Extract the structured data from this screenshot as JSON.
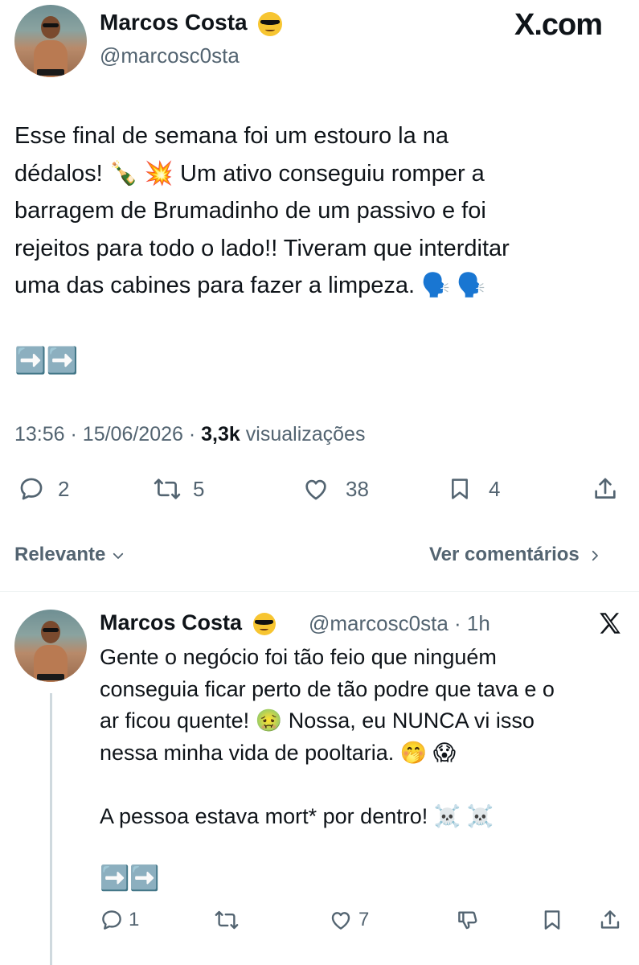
{
  "header": {
    "author_name": "Marcos Costa",
    "author_emoji": "😎",
    "handle": "@marcosc0sta",
    "site_logo": "X.com"
  },
  "main_post": {
    "text_lines": [
      "Esse final de semana foi um estouro la na",
      "dédalos! 🍾 💥 Um ativo conseguiu romper a",
      "barragem de Brumadinho de um passivo e foi",
      "rejeitos para todo o lado!! Tiveram que interditar",
      "uma das cabines para fazer a limpeza. 🗣️ 🗣️"
    ],
    "arrows": "➡️➡️",
    "time": "13:56",
    "date": "15/06/2026",
    "views_count": "3,3k",
    "views_label": "visualizações",
    "actions": {
      "replies": "2",
      "reposts": "5",
      "likes": "38",
      "bookmarks": "4"
    }
  },
  "sort_bar": {
    "left_label": "Relevante",
    "right_label": "Ver comentários"
  },
  "reply": {
    "author_name": "Marcos Costa",
    "author_emoji": "😎",
    "handle": "@marcosc0sta",
    "time_ago": "1h",
    "text_lines": [
      "Gente o negócio foi tão feio que ninguém",
      "conseguia ficar perto de tão podre que tava e o",
      "ar ficou quente! 🤢 Nossa, eu NUNCA vi isso",
      "nessa minha vida de pooltaria. 🤭 😱"
    ],
    "text_line_2": "A pessoa estava mort* por dentro! ☠️ ☠️",
    "arrows": "➡️➡️",
    "actions": {
      "replies": "1",
      "likes": "7"
    }
  },
  "colors": {
    "text": "#0f1419",
    "secondary": "#536471",
    "divider": "#eff3f4",
    "thread_line": "#cfd9de"
  },
  "icons": [
    "reply-icon",
    "repost-icon",
    "like-icon",
    "bookmark-icon",
    "share-icon",
    "dislike-icon",
    "x-logo-icon",
    "chevron-down-icon",
    "chevron-right-icon"
  ]
}
